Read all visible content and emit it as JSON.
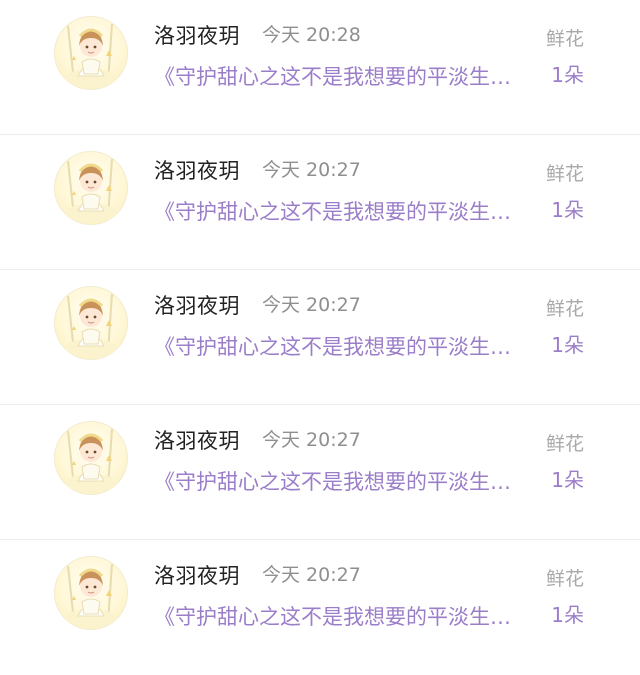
{
  "list": {
    "items": [
      {
        "user_name": "洛羽夜玥",
        "time": "今天 20:28",
        "book_title": "《守护甜心之这不是我想要的平淡生活》",
        "gift_type": "鲜花",
        "quantity": "1朵"
      },
      {
        "user_name": "洛羽夜玥",
        "time": "今天 20:27",
        "book_title": "《守护甜心之这不是我想要的平淡生活》",
        "gift_type": "鲜花",
        "quantity": "1朵"
      },
      {
        "user_name": "洛羽夜玥",
        "time": "今天 20:27",
        "book_title": "《守护甜心之这不是我想要的平淡生活》",
        "gift_type": "鲜花",
        "quantity": "1朵"
      },
      {
        "user_name": "洛羽夜玥",
        "time": "今天 20:27",
        "book_title": "《守护甜心之这不是我想要的平淡生活》",
        "gift_type": "鲜花",
        "quantity": "1朵"
      },
      {
        "user_name": "洛羽夜玥",
        "time": "今天 20:27",
        "book_title": "《守护甜心之这不是我想要的平淡生活》",
        "gift_type": "鲜花",
        "quantity": "1朵"
      }
    ]
  },
  "colors": {
    "accent": "#9b7ec9",
    "name_text": "#222222",
    "meta_text": "#8f8f8f"
  },
  "icons": {
    "avatar": "anime-girl-avatar"
  }
}
